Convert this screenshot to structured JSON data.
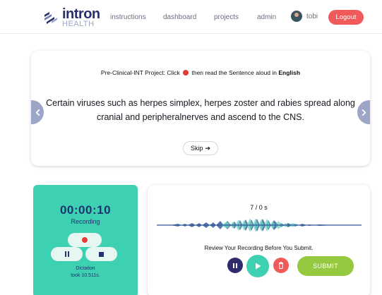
{
  "brand": {
    "name": "intron",
    "sub": "HEALTH",
    "color": "#2b2f6b",
    "sub_color": "#9aa6c8"
  },
  "nav": {
    "links": [
      {
        "label": "instructions"
      },
      {
        "label": "dashboard"
      },
      {
        "label": "projects"
      },
      {
        "label": "admin"
      }
    ],
    "user": {
      "name": "tobi"
    },
    "logout_label": "Logout"
  },
  "sentence_card": {
    "instruction_prefix": "Pre-Clinical-INT Project:",
    "instruction_click": "Click",
    "instruction_middle": "then read the Sentence aloud in",
    "instruction_language": "English",
    "sentence": "Certain viruses such as herpes simplex, herpes zoster and rabies spread along cranial and peripheralnerves and ascend to the CNS.",
    "skip_label": "Skip"
  },
  "recorder": {
    "timer": "00:00:10",
    "status": "Recording",
    "dictation_line1": "Dictation",
    "dictation_line2": "took 10.511s."
  },
  "review": {
    "counter": "7 / 0 s",
    "text": "Review Your Recording Before You Submit.",
    "submit_label": "SUBMIT"
  },
  "colors": {
    "accent_teal": "#3ed1b1",
    "navy": "#1e3370",
    "logout_red": "#f15a5a",
    "submit_green": "#95c940",
    "arrow_gray": "#9ea6c8"
  },
  "icons": {
    "logo": "intron-logo-icon",
    "record": "record-dot-icon",
    "pause": "pause-icon",
    "stop": "stop-icon",
    "play": "play-icon",
    "delete": "trash-icon",
    "skip": "arrow-right-icon",
    "prev": "chevron-left-icon",
    "next": "chevron-right-icon"
  }
}
